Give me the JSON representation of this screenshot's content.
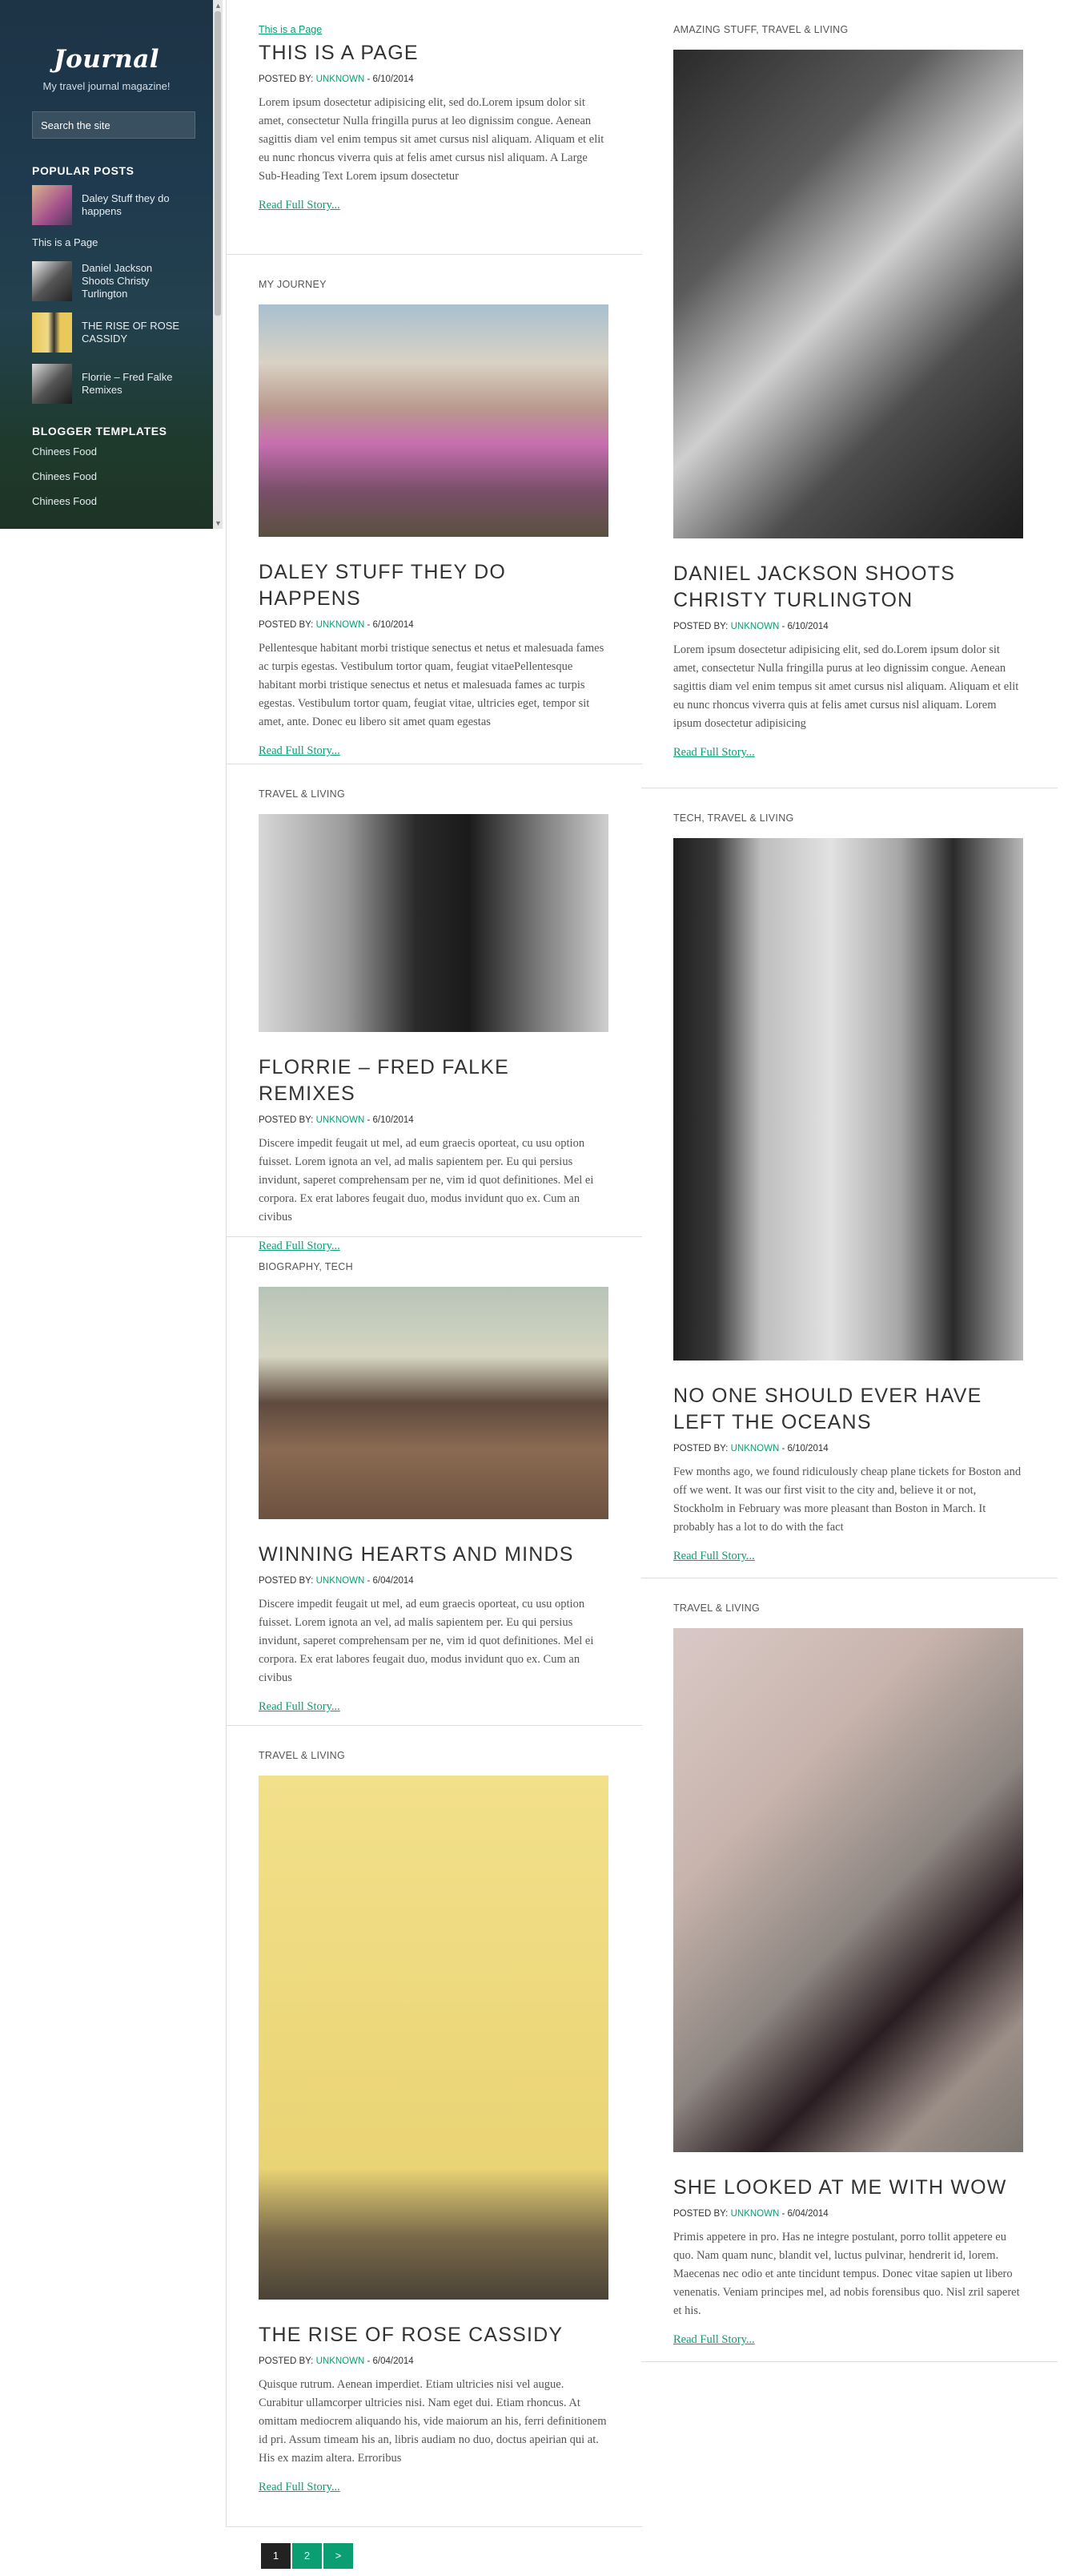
{
  "sidebar": {
    "logo": "Journal",
    "tagline": "My travel journal magazine!",
    "search_placeholder": "Search the site",
    "popular_heading": "POPULAR POSTS",
    "popular_posts": [
      {
        "title": "Daley Stuff they do happens"
      },
      {
        "title": "This is a Page"
      },
      {
        "title": "Daniel Jackson Shoots Christy Turlington"
      },
      {
        "title": "THE RISE OF ROSE CASSIDY"
      },
      {
        "title": "Florrie – Fred Falke Remixes"
      }
    ],
    "templates_heading": "BLOGGER TEMPLATES",
    "template_links": [
      "Chinees Food",
      "Chinees Food",
      "Chinees Food"
    ]
  },
  "posts": [
    {
      "category": "This is a Page",
      "title": "THIS IS A PAGE",
      "posted_by": "POSTED BY:",
      "author": "UNKNOWN",
      "date": "- 6/10/2014",
      "excerpt": "Lorem ipsum dosectetur adipisicing elit, sed do.Lorem ipsum dolor sit amet, consectetur Nulla fringilla purus at leo dignissim congue. Aenean sagittis diam vel enim tempus sit amet cursus nisl aliquam. Aliquam et elit eu nunc rhoncus viverra quis at felis amet cursus nisl aliquam. A Large Sub-Heading Text Lorem ipsum dosectetur",
      "more": "Read Full Story..."
    },
    {
      "category": "MY JOURNEY",
      "title": "DALEY STUFF THEY DO HAPPENS",
      "posted_by": "POSTED BY:",
      "author": "UNKNOWN",
      "date": "- 6/10/2014",
      "excerpt": "Pellentesque habitant morbi tristique senectus et netus et malesuada fames ac turpis egestas. Vestibulum tortor quam, feugiat vitaePellentesque habitant morbi tristique senectus et netus et malesuada fames ac turpis egestas. Vestibulum tortor quam, feugiat vitae, ultricies eget, tempor sit amet, ante. Donec eu libero sit amet quam egestas",
      "more": "Read Full Story..."
    },
    {
      "category": "TRAVEL & LIVING",
      "title": "FLORRIE – FRED FALKE REMIXES",
      "posted_by": "POSTED BY:",
      "author": "UNKNOWN",
      "date": "- 6/10/2014",
      "excerpt": "Discere impedit feugait ut mel, ad eum graecis oporteat, cu usu option fuisset. Lorem ignota an vel, ad malis sapientem per. Eu qui persius invidunt, saperet comprehensam per ne, vim id quot definitiones. Mel ei corpora. Ex erat labores feugait duo, modus invidunt quo ex. Cum an civibus",
      "more": "Read Full Story..."
    },
    {
      "category": "BIOGRAPHY, TECH",
      "title": "WINNING HEARTS AND MINDS",
      "posted_by": "POSTED BY:",
      "author": "UNKNOWN",
      "date": "- 6/04/2014",
      "excerpt": "Discere impedit feugait ut mel, ad eum graecis oporteat, cu usu option fuisset. Lorem ignota an vel, ad malis sapientem per. Eu qui persius invidunt, saperet comprehensam per ne, vim id quot definitiones. Mel ei corpora. Ex erat labores feugait duo, modus invidunt quo ex. Cum an civibus",
      "more": "Read Full Story..."
    },
    {
      "category": "TRAVEL & LIVING",
      "title": "THE RISE OF ROSE CASSIDY",
      "posted_by": "POSTED BY:",
      "author": "UNKNOWN",
      "date": "- 6/04/2014",
      "excerpt": "Quisque rutrum. Aenean imperdiet. Etiam ultricies nisi vel augue. Curabitur ullamcorper ultricies nisi. Nam eget dui. Etiam rhoncus. At omittam mediocrem aliquando his, vide maiorum an his, ferri definitionem id pri. Assum timeam his an, libris audiam no duo, doctus apeirian qui at. His ex mazim altera. Erroribus",
      "more": "Read Full Story..."
    },
    {
      "category": "AMAZING STUFF, TRAVEL & LIVING",
      "title": "DANIEL JACKSON SHOOTS CHRISTY TURLINGTON",
      "posted_by": "POSTED BY:",
      "author": "UNKNOWN",
      "date": "- 6/10/2014",
      "excerpt": "Lorem ipsum dosectetur adipisicing elit, sed do.Lorem ipsum dolor sit amet, consectetur Nulla fringilla purus at leo dignissim congue. Aenean sagittis diam vel enim tempus sit amet cursus nisl aliquam. Aliquam et elit eu nunc rhoncus viverra quis at felis amet cursus nisl aliquam. Lorem ipsum dosectetur adipisicing",
      "more": "Read Full Story..."
    },
    {
      "category": "TECH, TRAVEL & LIVING",
      "title": "NO ONE SHOULD EVER HAVE LEFT THE OCEANS",
      "posted_by": "POSTED BY:",
      "author": "UNKNOWN",
      "date": "- 6/10/2014",
      "excerpt": "Few months ago, we found ridiculously cheap plane tickets for Boston and off we went. It was our first visit to the city and, believe it or not, Stockholm in February was more pleasant than Boston in March. It probably has a lot to do with the fact",
      "more": "Read Full Story..."
    },
    {
      "category": "TRAVEL & LIVING",
      "title": "SHE LOOKED AT ME WITH WOW",
      "posted_by": "POSTED BY:",
      "author": "UNKNOWN",
      "date": "- 6/04/2014",
      "excerpt": "Primis appetere in pro. Has ne integre postulant, porro tollit appetere eu quo. Nam quam nunc, blandit vel, luctus pulvinar, hendrerit id, lorem. Maecenas nec odio et ante tincidunt tempus. Donec vitae sapien ut libero venenatis. Veniam principes mel, ad nobis forensibus quo. Nisl zril saperet et his.",
      "more": "Read Full Story..."
    }
  ],
  "pagination": [
    "1",
    "2",
    ">"
  ]
}
